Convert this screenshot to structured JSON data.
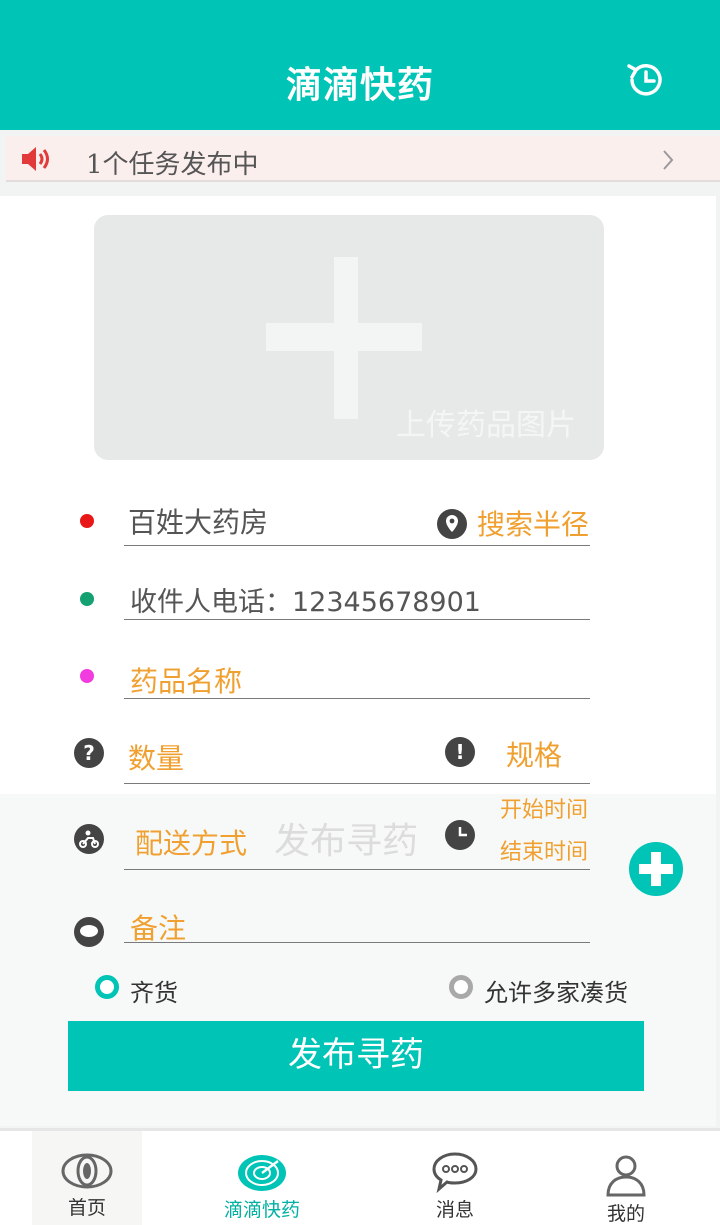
{
  "header": {
    "title": "滴滴快药",
    "history_icon": "history-icon"
  },
  "notice": {
    "text": "1个任务发布中",
    "icon": "speaker-icon"
  },
  "upload": {
    "label": "上传药品图片",
    "icon": "plus-icon"
  },
  "form": {
    "pharmacy": "百姓大药房",
    "search_radius": "搜索半径",
    "phone": "收件人电话：12345678901",
    "drug_name": "药品名称",
    "quantity": "数量",
    "spec": "规格",
    "delivery": "配送方式",
    "start_time": "开始时间",
    "end_time": "结束时间",
    "remark": "备注",
    "ghost_text": "发布寻药"
  },
  "options": {
    "full_stock": "齐货",
    "multi_store": "允许多家凑货"
  },
  "publish_button": "发布寻药",
  "tabs": [
    {
      "label": "首页",
      "icon": "eye-icon"
    },
    {
      "label": "滴滴快药",
      "icon": "radar-icon"
    },
    {
      "label": "消息",
      "icon": "message-icon"
    },
    {
      "label": "我的",
      "icon": "user-icon"
    }
  ],
  "colors": {
    "primary": "#00c4b6",
    "accent": "#f0a030",
    "red_dot": "#e81818",
    "green_dot": "#14a070",
    "pink_dot": "#f23ce0"
  }
}
